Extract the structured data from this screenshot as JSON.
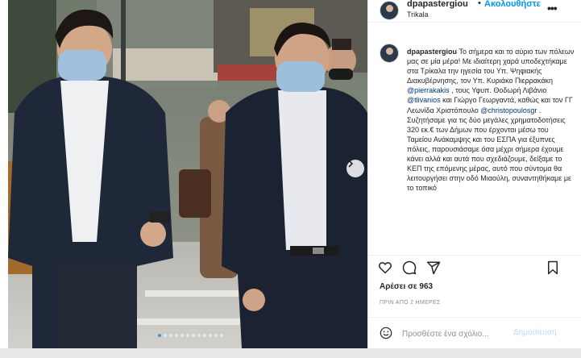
{
  "post": {
    "username": "dpapastergiou",
    "separator": "•",
    "follow_label": "Ακολουθήστε",
    "location": "Trikala",
    "more_label": "•••"
  },
  "caption": {
    "username": "dpapastergiou",
    "text_1": " Το σήμερα και το αύριο των πόλεων μας σε μία μέρα! Με ιδιαίτερη χαρά υποδεχτήκαμε στα Τρίκαλα την ηγεσία του Υπ. Ψηφιακής Διακυβέρνησης, τον Υπ. Κυριάκο Πιερρακάκη ",
    "mention_1": "@pierrakakis",
    "text_2": " , τους Υφυπ. Θοδωρή Λιβάνιο ",
    "mention_2": "@tlivanios",
    "text_3": " και Γιώργο Γεωργαντά, καθώς και τον ΓΓ Λεωνίδα Χριστόπουλο ",
    "mention_3": "@christopoulosgr",
    "text_4": " . Συζητήσαμε για τις δύο μεγάλες χρηματοδοτήσεις 320 εκ.€ των Δήμων που έρχονται μέσω του Ταμείου Ανάκαμψης και του ΕΣΠΑ για έξυπνες πόλεις, παρουσιάσαμε όσα μέχρι σήμερα έχουμε κάνει αλλά και αυτά που σχεδιάζουμε, δείξαμε το ΚΕΠ της επόμενης μέρας, αυτό που σύντομα θα λειτουργήσει στην οδό Μιαούλη, συναντηθήκαμε με το τοπικό"
  },
  "stats": {
    "likes": "Αρέσει σε 963",
    "time": "ΠΡΙΝ ΑΠΟ 2 ΗΜΕΡΕΣ"
  },
  "comment": {
    "placeholder": "Προσθέστε ένα σχόλιο...",
    "post_label": "Δημοσίευση"
  },
  "carousel": {
    "count": 12,
    "active_index": 0
  },
  "colors": {
    "accent": "#0095f6",
    "mention": "#00376b",
    "active_dot": "#3897f0"
  }
}
